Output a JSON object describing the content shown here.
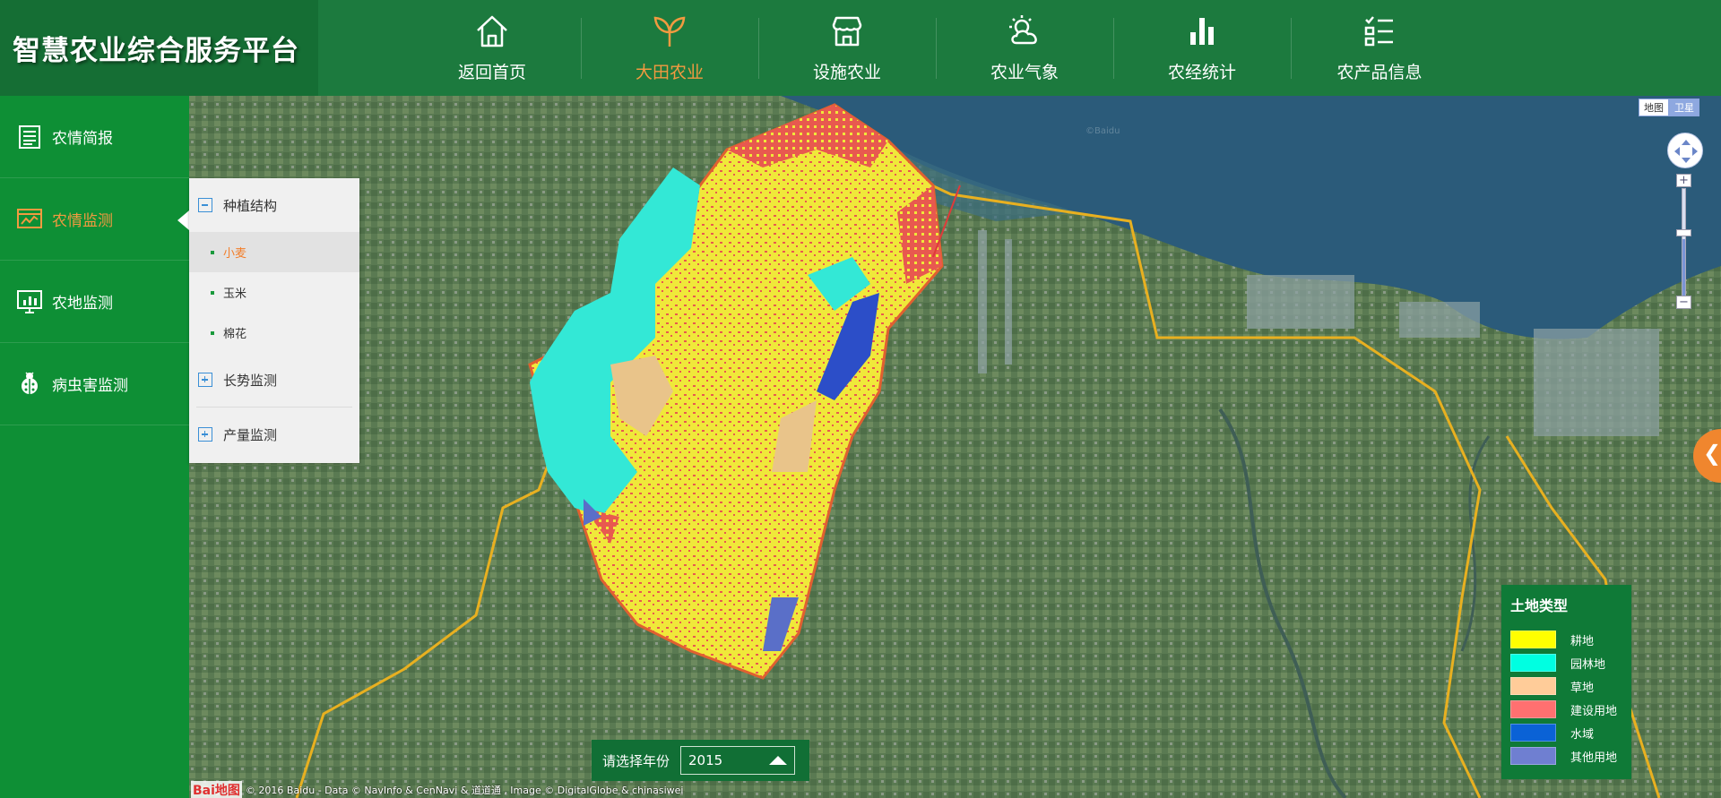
{
  "app_title": "智慧农业综合服务平台",
  "nav": [
    {
      "label": "返回首页",
      "icon": "home-icon"
    },
    {
      "label": "大田农业",
      "icon": "sprout-icon",
      "active": true
    },
    {
      "label": "设施农业",
      "icon": "greenhouse-icon"
    },
    {
      "label": "农业气象",
      "icon": "weather-icon"
    },
    {
      "label": "农经统计",
      "icon": "bar-chart-icon"
    },
    {
      "label": "农产品信息",
      "icon": "checklist-icon"
    }
  ],
  "sidebar": {
    "items": [
      {
        "label": "农情简报",
        "icon": "report-icon"
      },
      {
        "label": "农情监测",
        "icon": "monitor-chart-icon",
        "active": true
      },
      {
        "label": "农地监测",
        "icon": "farmland-monitor-icon"
      },
      {
        "label": "病虫害监测",
        "icon": "bug-icon"
      }
    ]
  },
  "submenu": {
    "group1": {
      "label": "种植结构",
      "expanded": true
    },
    "crops": [
      {
        "label": "小麦",
        "selected": true
      },
      {
        "label": "玉米"
      },
      {
        "label": "棉花"
      }
    ],
    "group2": {
      "label": "长势监测"
    },
    "group3": {
      "label": "产量监测"
    }
  },
  "map_type": {
    "map": "地图",
    "satellite": "卫星"
  },
  "legend": {
    "title": "土地类型",
    "items": [
      {
        "label": "耕地",
        "color": "#ffff00"
      },
      {
        "label": "园林地",
        "color": "#00ffe1"
      },
      {
        "label": "草地",
        "color": "#ffcc99"
      },
      {
        "label": "建设用地",
        "color": "#ff7070"
      },
      {
        "label": "水域",
        "color": "#0a62d6"
      },
      {
        "label": "其他用地",
        "color": "#6f7fd1"
      }
    ]
  },
  "year_selector": {
    "label": "请选择年份",
    "value": "2015"
  },
  "credits": {
    "logo": "Bai地图",
    "text": "© 2016 Baidu - Data © NavInfo & CenNavi & 道道通 , Image © DigitalGlobe & chinasiwei"
  },
  "zoom": {
    "in": "+",
    "out": "−"
  },
  "colors": {
    "header_bg": "#1c7a3e",
    "sidebar_bg": "#0e8f35",
    "accent": "#f29a40",
    "region_border": "#e06030",
    "district_line": "#e8b020",
    "sea": "#2b5b7a"
  }
}
